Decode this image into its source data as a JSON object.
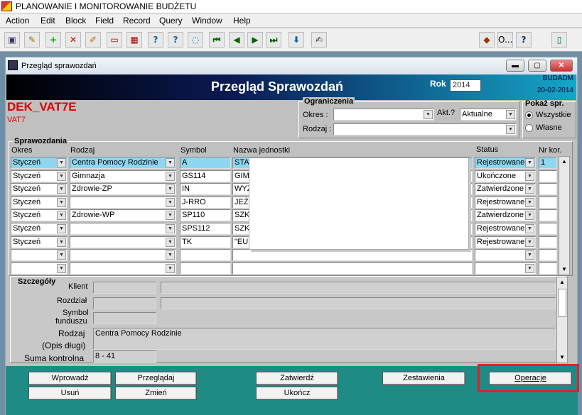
{
  "app_title": "PLANOWANIE I MONITOROWANIE BUDŻETU",
  "menu": [
    "Action",
    "Edit",
    "Block",
    "Field",
    "Record",
    "Query",
    "Window",
    "Help"
  ],
  "toolbar_right": {
    "o_label": "O...",
    "help_label": "?"
  },
  "window": {
    "title": "Przegląd sprawozdań",
    "min": "▬",
    "max": "▢",
    "close": "✕"
  },
  "banner": {
    "title": "Przegląd Sprawozdań",
    "rok_label": "Rok",
    "rok_value": "2014",
    "user": "BUDADM",
    "date": "20-02-2014"
  },
  "report": {
    "code": "DEK_VAT7E",
    "sub": "VAT7"
  },
  "filters": {
    "title": "Ograniczenia",
    "okres_label": "Okres :",
    "akt_label": "Akt.?",
    "akt_value": "Aktualne",
    "rodzaj_label": "Rodzaj :"
  },
  "show": {
    "title": "Pokaż spr.",
    "opt1": "Wszystkie",
    "opt2": "Własne"
  },
  "table": {
    "title": "Sprawozdania",
    "headers": {
      "okres": "Okres",
      "rodzaj": "Rodzaj",
      "symbol": "Symbol",
      "nazwa": "Nazwa jednostki",
      "status": "Status",
      "nrkor": "Nr kor."
    },
    "rows": [
      {
        "okres": "Styczeń",
        "rodzaj": "Centra Pomocy Rodzinie",
        "symbol": "A",
        "nazwa": "STA",
        "status": "Rejestrowane",
        "nrkor": "1"
      },
      {
        "okres": "Styczeń",
        "rodzaj": "Gimnazja",
        "symbol": "GS114",
        "nazwa": "GIM",
        "status": "Ukończone",
        "nrkor": ""
      },
      {
        "okres": "Styczeń",
        "rodzaj": "Zdrowie-ZP",
        "symbol": "IN",
        "nazwa": "WYŻ",
        "status": "Zatwierdzone",
        "nrkor": ""
      },
      {
        "okres": "Styczeń",
        "rodzaj": "",
        "symbol": "J-RRO",
        "nazwa": "JEŻ",
        "status": "Rejestrowane",
        "nrkor": ""
      },
      {
        "okres": "Styczeń",
        "rodzaj": "Zdrowie-WP",
        "symbol": "SP110",
        "nazwa": "SZK",
        "status": "Zatwierdzone",
        "nrkor": ""
      },
      {
        "okres": "Styczeń",
        "rodzaj": "",
        "symbol": "SPS112",
        "nazwa": "SZK",
        "status": "Rejestrowane",
        "nrkor": ""
      },
      {
        "okres": "Styczeń",
        "rodzaj": "",
        "symbol": "TK",
        "nazwa": "\"EU",
        "status": "Rejestrowane",
        "nrkor": ""
      }
    ]
  },
  "details": {
    "title": "Szczegóły",
    "klient_label": "Klient",
    "rozdzial_label": "Rozdział",
    "symbol_label1": "Symbol",
    "symbol_label2": "funduszu",
    "rodzaj_label1": "Rodzaj",
    "rodzaj_label2": "(Opis długi)",
    "rodzaj_value": "Centra Pomocy Rodzinie",
    "suma_label": "Suma kontrolna",
    "suma_value": "8 - 41"
  },
  "buttons": {
    "wprowadz": "Wprowadź",
    "przegladaj": "Przeglądaj",
    "zatwierdz": "Zatwierdź",
    "zestawienia": "Zestawienia",
    "operacje": "Operacje",
    "usun": "Usuń",
    "zmien": "Zmień",
    "ukoncz": "Ukończ"
  },
  "colors": {
    "highlight_box": "#e0202a",
    "footer_bg": "#1e8c84",
    "selected_row": "#8fd7f0"
  }
}
